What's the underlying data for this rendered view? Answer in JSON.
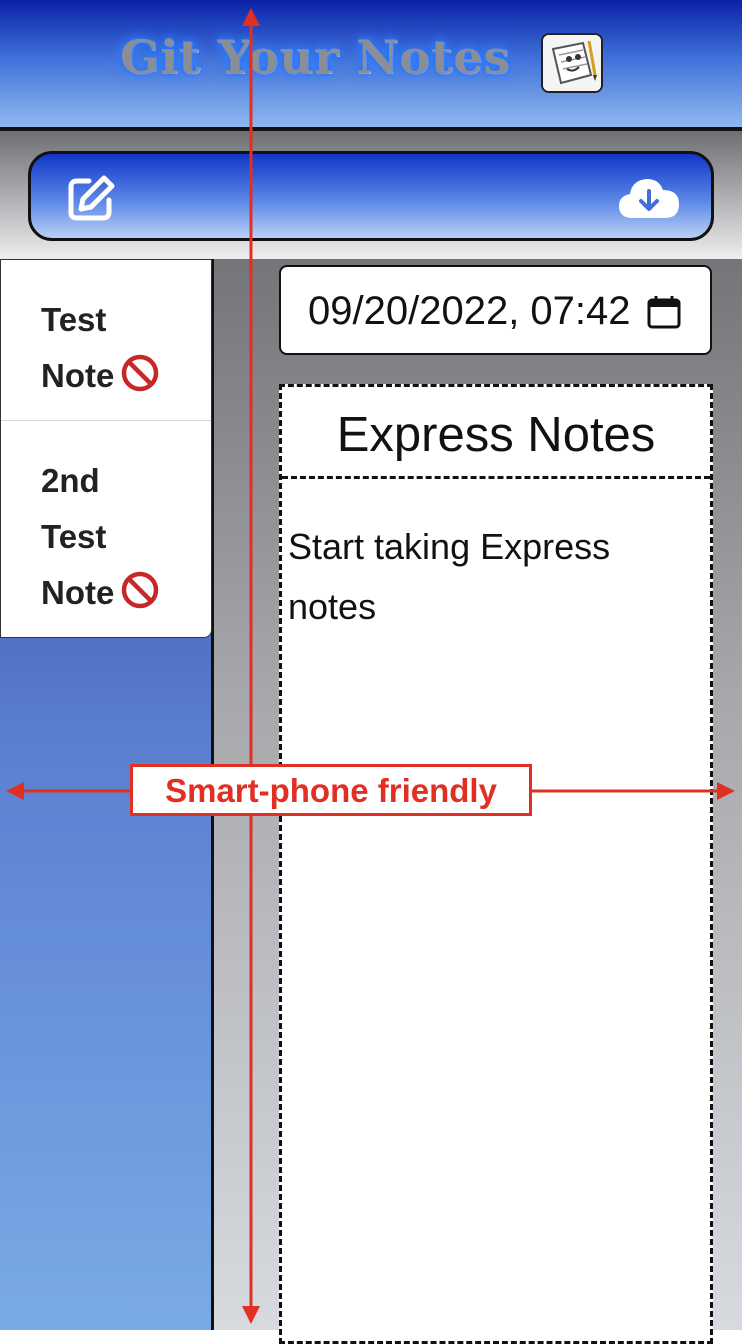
{
  "header": {
    "title": "Git Your Notes",
    "logo_icon": "notepad-mascot-icon",
    "brand_color": "#1236c8"
  },
  "toolbar": {
    "new_note_icon": "edit-icon",
    "save_icon": "cloud-download-icon"
  },
  "sidebar": {
    "notes": [
      {
        "title_lines": [
          "Test",
          "Note"
        ],
        "delete_icon": "no-entry-icon"
      },
      {
        "title_lines": [
          "2nd",
          "Test",
          "Note"
        ],
        "delete_icon": "no-entry-icon"
      }
    ]
  },
  "editor": {
    "date_value": "09/20/2022, 07:42",
    "note_title": "Express Notes",
    "note_body": "Start taking Express notes"
  },
  "annotation": {
    "label": "Smart-phone friendly",
    "color": "#e03024"
  }
}
